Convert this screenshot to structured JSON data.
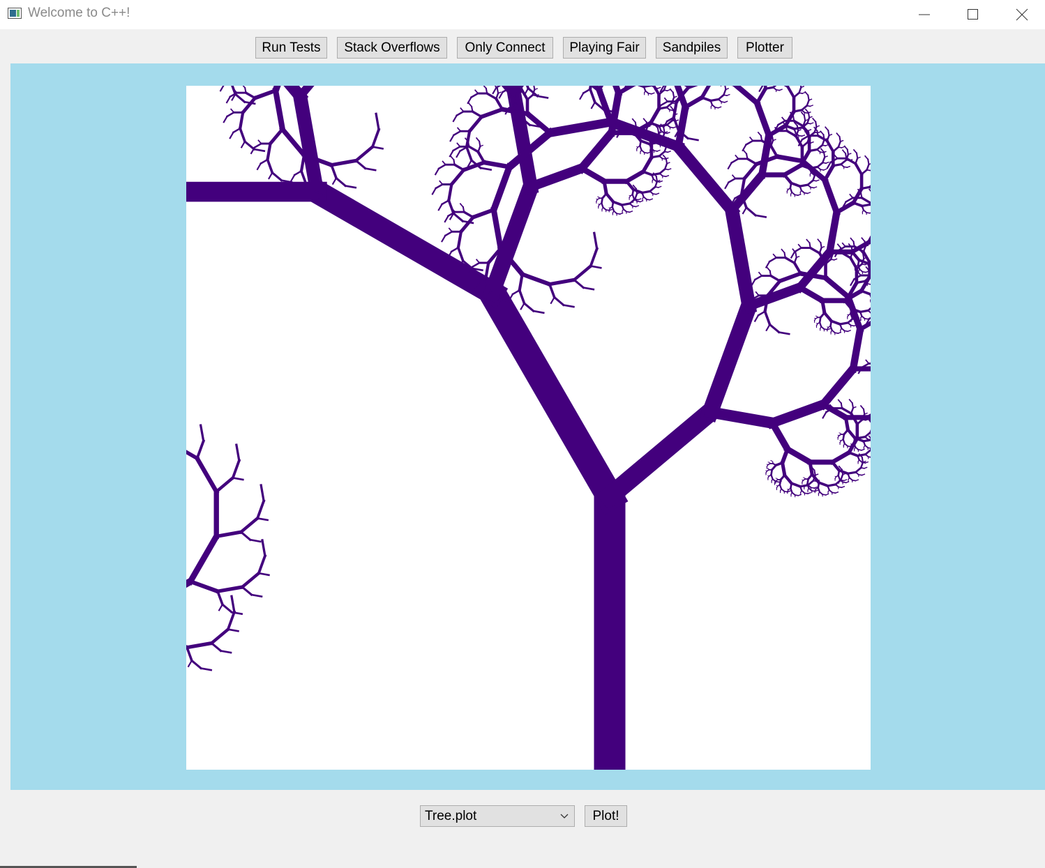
{
  "window": {
    "title": "Welcome to C++!",
    "controls": [
      "minimize-icon",
      "maximize-icon",
      "close-icon"
    ]
  },
  "toolbar": {
    "buttons": [
      {
        "label": "Run Tests"
      },
      {
        "label": "Stack Overflows"
      },
      {
        "label": "Only Connect"
      },
      {
        "label": "Playing Fair"
      },
      {
        "label": "Sandpiles"
      },
      {
        "label": "Plotter"
      }
    ]
  },
  "canvas": {
    "background_color": "#a4dbec",
    "plot_background": "#ffffff",
    "drawing_color": "#43007d",
    "drawing": "fractal-tree"
  },
  "controls": {
    "file_select": {
      "value": "Tree.plot"
    },
    "plot_button": {
      "label": "Plot!"
    }
  }
}
